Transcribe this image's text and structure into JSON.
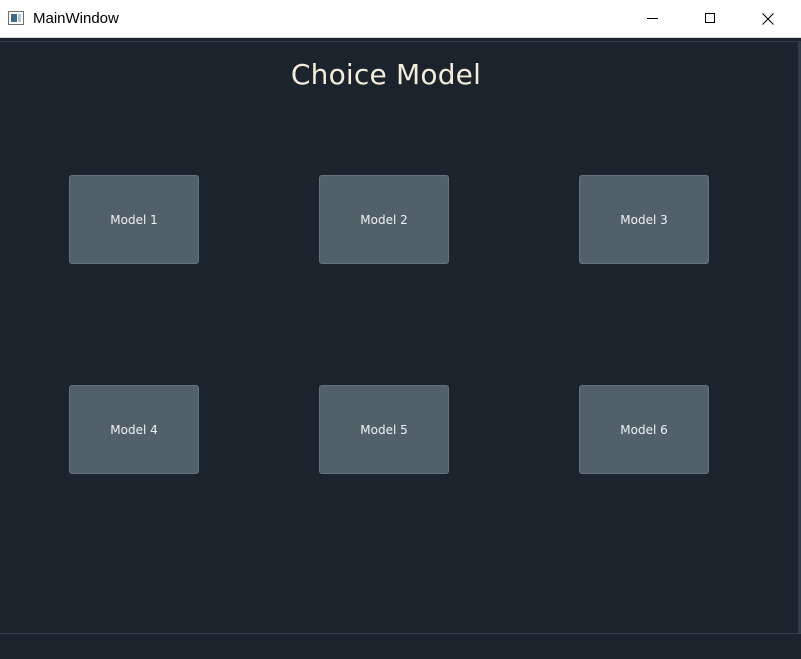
{
  "window": {
    "title": "MainWindow",
    "controls": {
      "minimize": "minimize",
      "maximize": "maximize",
      "close": "close"
    }
  },
  "main": {
    "title": "Choice Model",
    "buttons": [
      {
        "label": "Model 1"
      },
      {
        "label": "Model 2"
      },
      {
        "label": "Model 3"
      },
      {
        "label": "Model 4"
      },
      {
        "label": "Model 5"
      },
      {
        "label": "Model 6"
      }
    ]
  },
  "colors": {
    "background": "#1b232c",
    "button": "#526069",
    "title_text": "#f3ecd9"
  }
}
